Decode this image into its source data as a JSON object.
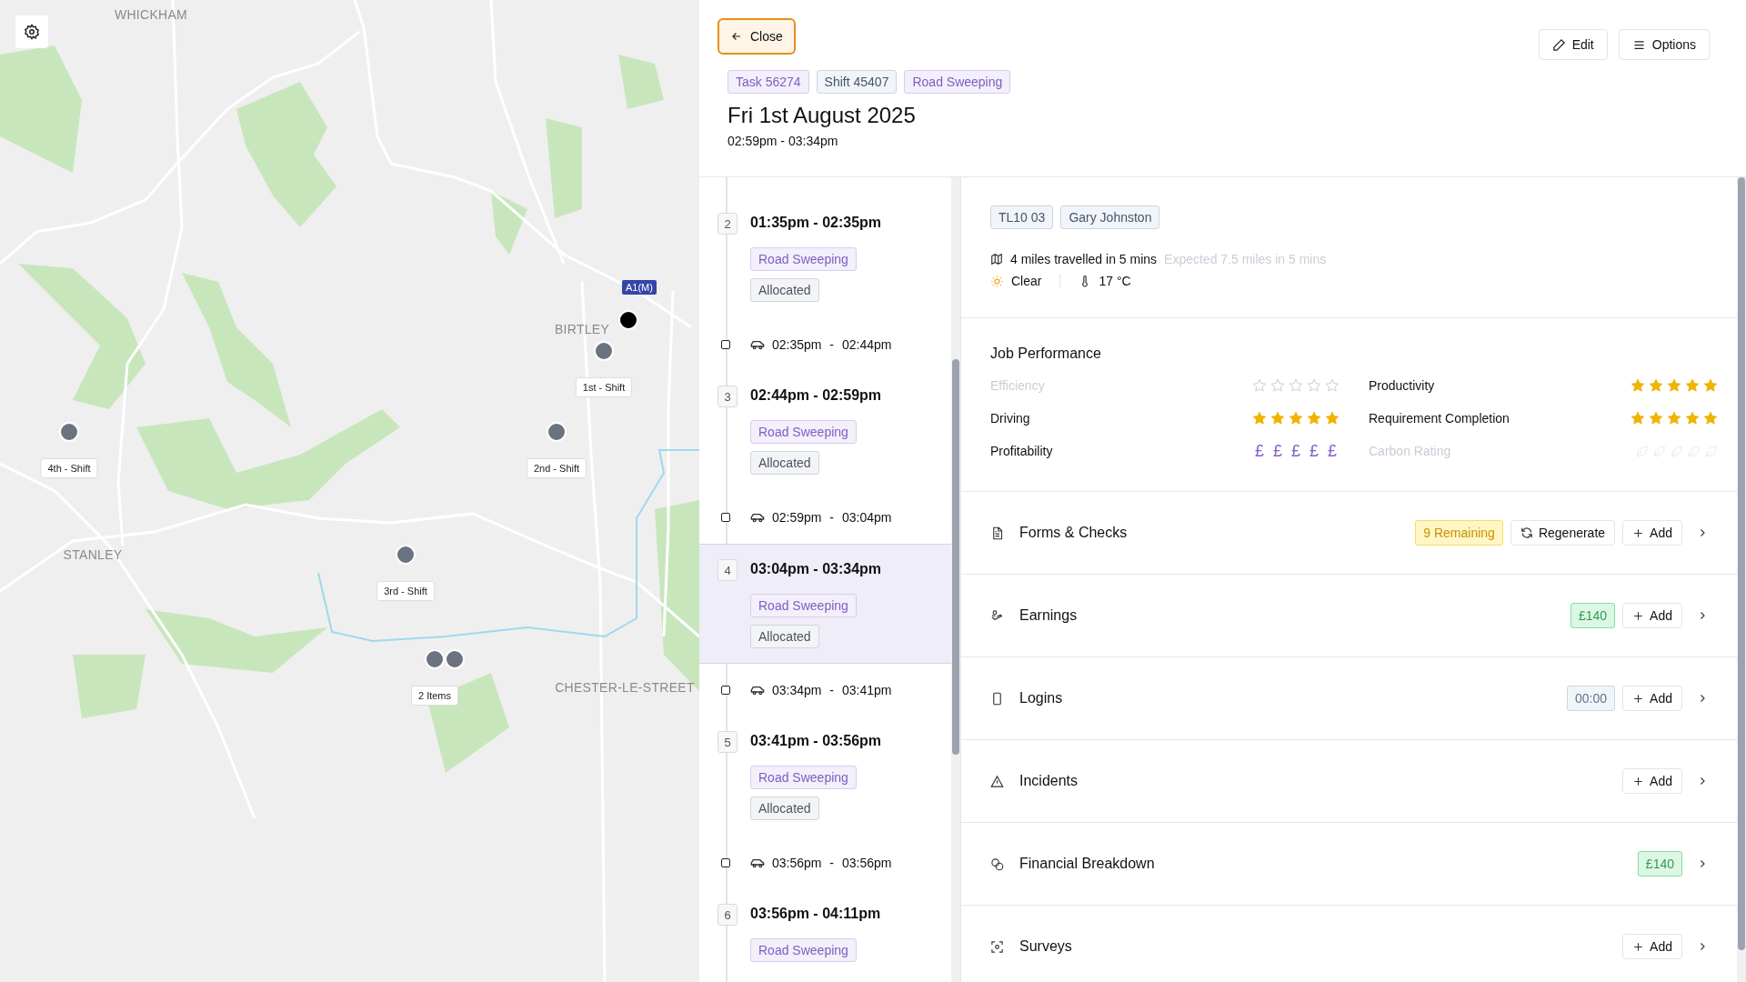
{
  "map": {
    "places": [
      "WHICKHAM",
      "STANLEY",
      "BIRTLEY",
      "CHESTER-LE-STREET"
    ],
    "road_sign": "A1(M)",
    "markers": [
      {
        "label": "1st - Shift",
        "kind": "shift"
      },
      {
        "label": "2nd - Shift",
        "kind": "shift"
      },
      {
        "label": "3rd - Shift",
        "kind": "shift"
      },
      {
        "label": "4th - Shift",
        "kind": "shift"
      },
      {
        "label": "2 Items",
        "kind": "cluster"
      }
    ]
  },
  "header": {
    "close_button": "Close",
    "actions": [
      {
        "label": "Edit",
        "kind": "edit"
      },
      {
        "label": "Options",
        "kind": "options"
      }
    ],
    "tags": [
      {
        "text": "Task 56274",
        "kind": "type"
      },
      {
        "text": "Shift 45407",
        "kind": "neutral"
      },
      {
        "text": "Road Sweeping",
        "kind": "type"
      }
    ],
    "title": "Fri 1st August 2025",
    "time": "02:59pm - 03:34pm"
  },
  "timeline": [
    {
      "kind": "stop",
      "number": "2",
      "time": "01:35pm - 02:35pm",
      "selected": false,
      "tags": [
        {
          "text": "Road Sweeping",
          "kind": "type"
        },
        {
          "text": "Allocated",
          "kind": "status"
        }
      ]
    },
    {
      "kind": "travel",
      "time": "02:35pm - 02:44pm"
    },
    {
      "kind": "stop",
      "number": "3",
      "time": "02:44pm - 02:59pm",
      "selected": false,
      "tags": [
        {
          "text": "Road Sweeping",
          "kind": "type"
        },
        {
          "text": "Allocated",
          "kind": "status"
        }
      ]
    },
    {
      "kind": "travel",
      "time": "02:59pm - 03:04pm"
    },
    {
      "kind": "stop",
      "number": "4",
      "time": "03:04pm - 03:34pm",
      "selected": true,
      "tags": [
        {
          "text": "Road Sweeping",
          "kind": "type"
        },
        {
          "text": "Allocated",
          "kind": "status"
        }
      ]
    },
    {
      "kind": "travel",
      "time": "03:34pm - 03:41pm"
    },
    {
      "kind": "stop",
      "number": "5",
      "time": "03:41pm - 03:56pm",
      "selected": false,
      "tags": [
        {
          "text": "Road Sweeping",
          "kind": "type"
        },
        {
          "text": "Allocated",
          "kind": "status"
        }
      ]
    },
    {
      "kind": "travel",
      "time": "03:56pm - 03:56pm"
    },
    {
      "kind": "stop",
      "number": "6",
      "time": "03:56pm - 04:11pm",
      "selected": false,
      "tags": [
        {
          "text": "Road Sweeping",
          "kind": "type"
        }
      ]
    }
  ],
  "details": {
    "chips": [
      "TL10 03",
      "Gary Johnston"
    ],
    "travelled": "4 miles travelled in 5 mins",
    "expected": "Expected 7.5 miles in 5 mins",
    "weather": "Clear",
    "temperature": "17 °C"
  },
  "performance": {
    "title": "Job Performance",
    "metrics": [
      {
        "label": "Efficiency",
        "kind": "stars",
        "stars": 0
      },
      {
        "label": "Productivity",
        "kind": "stars",
        "stars": 5
      },
      {
        "label": "Driving",
        "kind": "stars",
        "stars": 5
      },
      {
        "label": "Requirement Completion",
        "kind": "stars",
        "stars": 5
      },
      {
        "label": "Profitability",
        "kind": "pounds",
        "symbol": "£",
        "stars": 5
      },
      {
        "label": "Carbon Rating",
        "kind": "leaves",
        "stars": 0
      }
    ]
  },
  "sections": [
    {
      "title": "Forms & Checks",
      "badge": {
        "text": "9 Remaining",
        "kind": "warning"
      },
      "buttons": [
        {
          "label": "Regenerate",
          "kind": "regenerate"
        },
        {
          "label": "Add",
          "kind": "add"
        }
      ]
    },
    {
      "title": "Earnings",
      "badge": {
        "text": "£140",
        "kind": "success"
      },
      "buttons": [
        {
          "label": "Add",
          "kind": "add"
        }
      ]
    },
    {
      "title": "Logins",
      "badge": {
        "text": "00:00",
        "kind": "neutral"
      },
      "buttons": [
        {
          "label": "Add",
          "kind": "add"
        }
      ]
    },
    {
      "title": "Incidents",
      "buttons": [
        {
          "label": "Add",
          "kind": "add"
        }
      ]
    },
    {
      "title": "Financial Breakdown",
      "badge": {
        "text": "£140",
        "kind": "success"
      }
    },
    {
      "title": "Surveys",
      "buttons": [
        {
          "label": "Add",
          "kind": "add"
        }
      ]
    }
  ]
}
